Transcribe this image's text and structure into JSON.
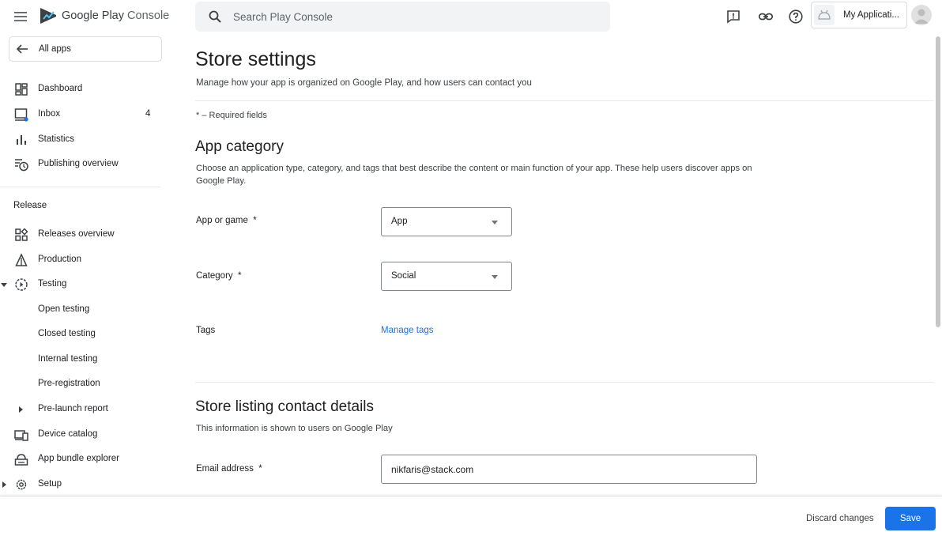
{
  "header": {
    "logo_text_1": "Google Play",
    "logo_text_2": "Console",
    "search_placeholder": "Search Play Console",
    "app_chip_name": "My Applicati...",
    "icons": [
      "menu-icon",
      "play-console-logo-icon",
      "search-icon",
      "feedback-icon",
      "link-icon",
      "help-icon",
      "android-icon",
      "avatar-icon"
    ]
  },
  "sidebar": {
    "all_apps": "All apps",
    "items": [
      {
        "label": "Dashboard",
        "icon": "dashboard-icon"
      },
      {
        "label": "Inbox",
        "icon": "inbox-icon",
        "badge": "4"
      },
      {
        "label": "Statistics",
        "icon": "statistics-icon"
      },
      {
        "label": "Publishing overview",
        "icon": "publishing-overview-icon"
      }
    ],
    "release_title": "Release",
    "release_items": [
      {
        "label": "Releases overview",
        "icon": "releases-overview-icon"
      },
      {
        "label": "Production",
        "icon": "production-icon"
      },
      {
        "label": "Testing",
        "icon": "testing-icon"
      },
      {
        "label": "Open testing"
      },
      {
        "label": "Closed testing"
      },
      {
        "label": "Internal testing"
      },
      {
        "label": "Pre-registration"
      },
      {
        "label": "Pre-launch report"
      },
      {
        "label": "Device catalog",
        "icon": "device-catalog-icon"
      },
      {
        "label": "App bundle explorer",
        "icon": "app-bundle-explorer-icon"
      },
      {
        "label": "Setup",
        "icon": "setup-icon"
      }
    ]
  },
  "main": {
    "title": "Store settings",
    "subtitle": "Manage how your app is organized on Google Play, and how users can contact you",
    "required_note": "* – Required fields",
    "app_category": {
      "title": "App category",
      "description": "Choose an application type, category, and tags that best describe the content or main function of your app. These help users discover apps on Google Play.",
      "app_or_game_label": "App or game  *",
      "app_or_game_value": "App",
      "category_label": "Category  *",
      "category_value": "Social",
      "tags_label": "Tags",
      "tags_link": "Manage tags"
    },
    "contact": {
      "title": "Store listing contact details",
      "description": "This information is shown to users on Google Play",
      "email_label": "Email address  *",
      "email_value": "nikfaris@stack.com"
    }
  },
  "footer": {
    "discard_label": "Discard changes",
    "save_label": "Save"
  },
  "colors": {
    "accent": "#1a73e8",
    "icon": "#5f6368",
    "text": "#202124",
    "divider": "#e8eaed"
  }
}
